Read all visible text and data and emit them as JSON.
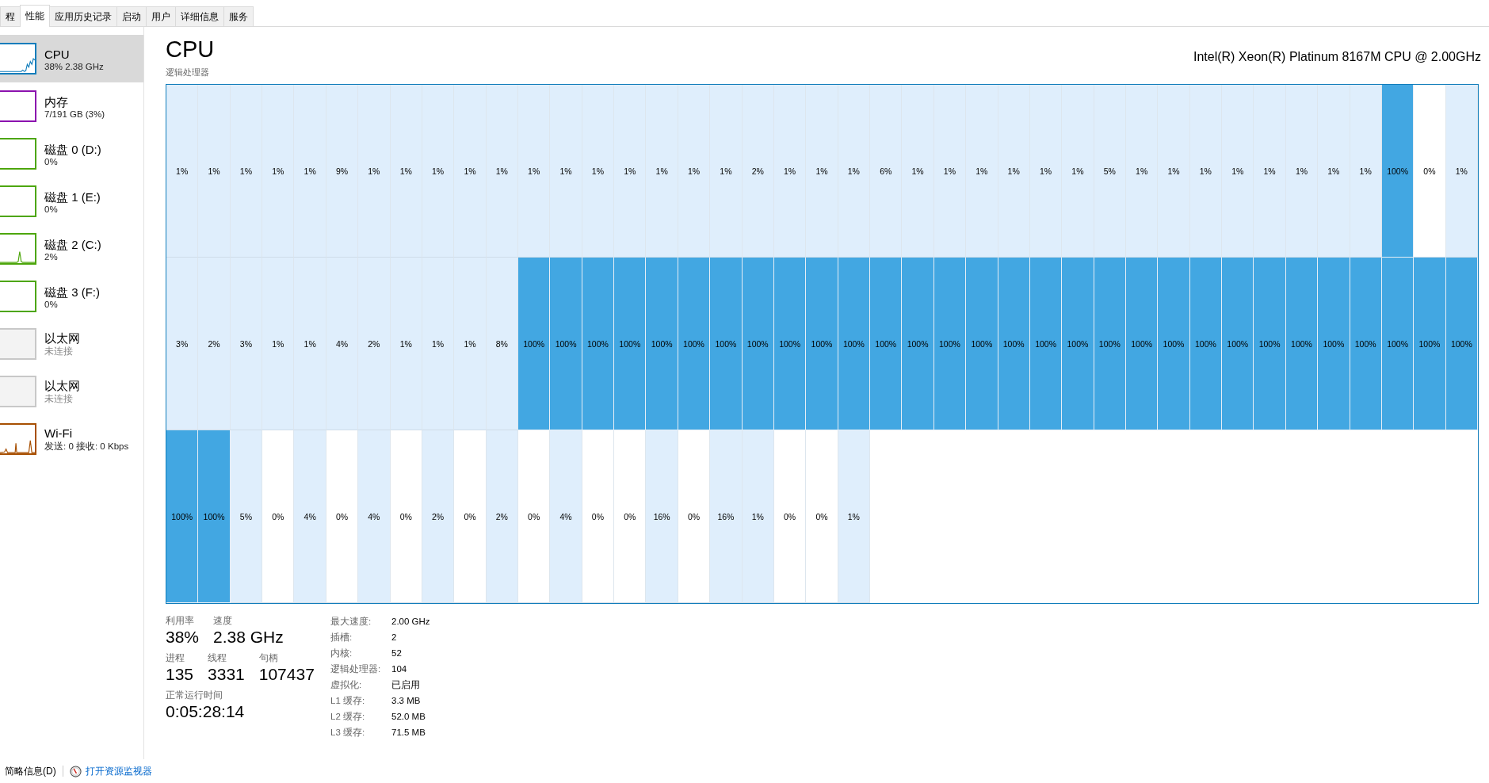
{
  "tabs": [
    {
      "label": "程",
      "selected": false
    },
    {
      "label": "性能",
      "selected": true
    },
    {
      "label": "应用历史记录",
      "selected": false
    },
    {
      "label": "启动",
      "selected": false
    },
    {
      "label": "用户",
      "selected": false
    },
    {
      "label": "详细信息",
      "selected": false
    },
    {
      "label": "服务",
      "selected": false
    }
  ],
  "sidebar": {
    "items": [
      {
        "kind": "cpu",
        "title": "CPU",
        "subtitle": "38% 2.38 GHz",
        "color": "#117dbb",
        "selected": true,
        "connected": true
      },
      {
        "kind": "memory",
        "title": "内存",
        "subtitle": "7/191 GB (3%)",
        "color": "#8b12ae",
        "selected": false,
        "connected": true
      },
      {
        "kind": "disk",
        "title": "磁盘 0 (D:)",
        "subtitle": "0%",
        "color": "#4da60c",
        "selected": false,
        "connected": true,
        "active": false
      },
      {
        "kind": "disk",
        "title": "磁盘 1 (E:)",
        "subtitle": "0%",
        "color": "#4da60c",
        "selected": false,
        "connected": true,
        "active": false
      },
      {
        "kind": "disk",
        "title": "磁盘 2 (C:)",
        "subtitle": "2%",
        "color": "#4da60c",
        "selected": false,
        "connected": true,
        "active": true
      },
      {
        "kind": "disk",
        "title": "磁盘 3 (F:)",
        "subtitle": "0%",
        "color": "#4da60c",
        "selected": false,
        "connected": true,
        "active": false
      },
      {
        "kind": "ethernet",
        "title": "以太网",
        "subtitle": "未连接",
        "color": "#c8c8c8",
        "selected": false,
        "connected": false
      },
      {
        "kind": "ethernet",
        "title": "以太网",
        "subtitle": "未连接",
        "color": "#c8c8c8",
        "selected": false,
        "connected": false
      },
      {
        "kind": "wifi",
        "title": "Wi-Fi",
        "subtitle": "发送: 0 接收: 0 Kbps",
        "color": "#a74f01",
        "selected": false,
        "connected": true
      }
    ]
  },
  "header": {
    "title": "CPU",
    "model": "Intel(R) Xeon(R) Platinum 8167M CPU @ 2.00GHz",
    "grid_label": "逻辑处理器"
  },
  "grid": {
    "rows": [
      [
        {
          "text": "1%",
          "busy": false,
          "idle": false
        },
        {
          "text": "1%",
          "busy": false,
          "idle": false
        },
        {
          "text": "1%",
          "busy": false,
          "idle": false
        },
        {
          "text": "1%",
          "busy": false,
          "idle": false
        },
        {
          "text": "1%",
          "busy": false,
          "idle": false
        },
        {
          "text": "9%",
          "busy": false,
          "idle": false
        },
        {
          "text": "1%",
          "busy": false,
          "idle": false
        },
        {
          "text": "1%",
          "busy": false,
          "idle": false
        },
        {
          "text": "1%",
          "busy": false,
          "idle": false
        },
        {
          "text": "1%",
          "busy": false,
          "idle": false
        },
        {
          "text": "1%",
          "busy": false,
          "idle": false
        },
        {
          "text": "1%",
          "busy": false,
          "idle": false
        },
        {
          "text": "1%",
          "busy": false,
          "idle": false
        },
        {
          "text": "1%",
          "busy": false,
          "idle": false
        },
        {
          "text": "1%",
          "busy": false,
          "idle": false
        },
        {
          "text": "1%",
          "busy": false,
          "idle": false
        },
        {
          "text": "1%",
          "busy": false,
          "idle": false
        },
        {
          "text": "1%",
          "busy": false,
          "idle": false
        },
        {
          "text": "2%",
          "busy": false,
          "idle": false
        },
        {
          "text": "1%",
          "busy": false,
          "idle": false
        },
        {
          "text": "1%",
          "busy": false,
          "idle": false
        },
        {
          "text": "1%",
          "busy": false,
          "idle": false
        },
        {
          "text": "6%",
          "busy": false,
          "idle": false
        },
        {
          "text": "1%",
          "busy": false,
          "idle": false
        },
        {
          "text": "1%",
          "busy": false,
          "idle": false
        },
        {
          "text": "1%",
          "busy": false,
          "idle": false
        },
        {
          "text": "1%",
          "busy": false,
          "idle": false
        },
        {
          "text": "1%",
          "busy": false,
          "idle": false
        },
        {
          "text": "1%",
          "busy": false,
          "idle": false
        },
        {
          "text": "5%",
          "busy": false,
          "idle": false
        },
        {
          "text": "1%",
          "busy": false,
          "idle": false
        },
        {
          "text": "1%",
          "busy": false,
          "idle": false
        },
        {
          "text": "1%",
          "busy": false,
          "idle": false
        },
        {
          "text": "1%",
          "busy": false,
          "idle": false
        },
        {
          "text": "1%",
          "busy": false,
          "idle": false
        },
        {
          "text": "1%",
          "busy": false,
          "idle": false
        },
        {
          "text": "1%",
          "busy": false,
          "idle": false
        },
        {
          "text": "1%",
          "busy": false,
          "idle": false
        },
        {
          "text": "100%",
          "busy": true,
          "idle": false
        },
        {
          "text": "0%",
          "busy": false,
          "idle": true
        },
        {
          "text": "1%",
          "busy": false,
          "idle": false
        }
      ],
      [
        {
          "text": "3%",
          "busy": false,
          "idle": false
        },
        {
          "text": "2%",
          "busy": false,
          "idle": false
        },
        {
          "text": "3%",
          "busy": false,
          "idle": false
        },
        {
          "text": "1%",
          "busy": false,
          "idle": false
        },
        {
          "text": "1%",
          "busy": false,
          "idle": false
        },
        {
          "text": "4%",
          "busy": false,
          "idle": false
        },
        {
          "text": "2%",
          "busy": false,
          "idle": false
        },
        {
          "text": "1%",
          "busy": false,
          "idle": false
        },
        {
          "text": "1%",
          "busy": false,
          "idle": false
        },
        {
          "text": "1%",
          "busy": false,
          "idle": false
        },
        {
          "text": "8%",
          "busy": false,
          "idle": false
        },
        {
          "text": "100%",
          "busy": true,
          "idle": false
        },
        {
          "text": "100%",
          "busy": true,
          "idle": false
        },
        {
          "text": "100%",
          "busy": true,
          "idle": false
        },
        {
          "text": "100%",
          "busy": true,
          "idle": false
        },
        {
          "text": "100%",
          "busy": true,
          "idle": false
        },
        {
          "text": "100%",
          "busy": true,
          "idle": false
        },
        {
          "text": "100%",
          "busy": true,
          "idle": false
        },
        {
          "text": "100%",
          "busy": true,
          "idle": false
        },
        {
          "text": "100%",
          "busy": true,
          "idle": false
        },
        {
          "text": "100%",
          "busy": true,
          "idle": false
        },
        {
          "text": "100%",
          "busy": true,
          "idle": false
        },
        {
          "text": "100%",
          "busy": true,
          "idle": false
        },
        {
          "text": "100%",
          "busy": true,
          "idle": false
        },
        {
          "text": "100%",
          "busy": true,
          "idle": false
        },
        {
          "text": "100%",
          "busy": true,
          "idle": false
        },
        {
          "text": "100%",
          "busy": true,
          "idle": false
        },
        {
          "text": "100%",
          "busy": true,
          "idle": false
        },
        {
          "text": "100%",
          "busy": true,
          "idle": false
        },
        {
          "text": "100%",
          "busy": true,
          "idle": false
        },
        {
          "text": "100%",
          "busy": true,
          "idle": false
        },
        {
          "text": "100%",
          "busy": true,
          "idle": false
        },
        {
          "text": "100%",
          "busy": true,
          "idle": false
        },
        {
          "text": "100%",
          "busy": true,
          "idle": false
        },
        {
          "text": "100%",
          "busy": true,
          "idle": false
        },
        {
          "text": "100%",
          "busy": true,
          "idle": false
        },
        {
          "text": "100%",
          "busy": true,
          "idle": false
        },
        {
          "text": "100%",
          "busy": true,
          "idle": false
        },
        {
          "text": "100%",
          "busy": true,
          "idle": false
        },
        {
          "text": "100%",
          "busy": true,
          "idle": false
        },
        {
          "text": "100%",
          "busy": true,
          "idle": false
        }
      ],
      [
        {
          "text": "100%",
          "busy": true,
          "idle": false
        },
        {
          "text": "100%",
          "busy": true,
          "idle": false
        },
        {
          "text": "5%",
          "busy": false,
          "idle": false
        },
        {
          "text": "0%",
          "busy": false,
          "idle": true
        },
        {
          "text": "4%",
          "busy": false,
          "idle": false
        },
        {
          "text": "0%",
          "busy": false,
          "idle": true
        },
        {
          "text": "4%",
          "busy": false,
          "idle": false
        },
        {
          "text": "0%",
          "busy": false,
          "idle": true
        },
        {
          "text": "2%",
          "busy": false,
          "idle": false
        },
        {
          "text": "0%",
          "busy": false,
          "idle": true
        },
        {
          "text": "2%",
          "busy": false,
          "idle": false
        },
        {
          "text": "0%",
          "busy": false,
          "idle": true
        },
        {
          "text": "4%",
          "busy": false,
          "idle": false
        },
        {
          "text": "0%",
          "busy": false,
          "idle": true
        },
        {
          "text": "0%",
          "busy": false,
          "idle": true
        },
        {
          "text": "16%",
          "busy": false,
          "idle": false
        },
        {
          "text": "0%",
          "busy": false,
          "idle": true
        },
        {
          "text": "16%",
          "busy": false,
          "idle": false
        },
        {
          "text": "1%",
          "busy": false,
          "idle": false
        },
        {
          "text": "0%",
          "busy": false,
          "idle": true
        },
        {
          "text": "0%",
          "busy": false,
          "idle": true
        },
        {
          "text": "1%",
          "busy": false,
          "idle": false
        }
      ]
    ]
  },
  "stats": {
    "primary": [
      [
        {
          "label": "利用率",
          "value": "38%"
        },
        {
          "label": "速度",
          "value": "2.38 GHz"
        }
      ],
      [
        {
          "label": "进程",
          "value": "135"
        },
        {
          "label": "线程",
          "value": "3331"
        },
        {
          "label": "句柄",
          "value": "107437"
        }
      ],
      [
        {
          "label": "正常运行时间",
          "value": "0:05:28:14"
        }
      ]
    ],
    "details": [
      {
        "label": "最大速度:",
        "value": "2.00 GHz"
      },
      {
        "label": "插槽:",
        "value": "2"
      },
      {
        "label": "内核:",
        "value": "52"
      },
      {
        "label": "逻辑处理器:",
        "value": "104"
      },
      {
        "label": "虚拟化:",
        "value": "已启用"
      },
      {
        "label": "L1 缓存:",
        "value": "3.3 MB"
      },
      {
        "label": "L2 缓存:",
        "value": "52.0 MB"
      },
      {
        "label": "L3 缓存:",
        "value": "71.5 MB"
      }
    ]
  },
  "footer": {
    "summary": "简略信息(D)",
    "monitor_link": "打开资源监视器"
  }
}
